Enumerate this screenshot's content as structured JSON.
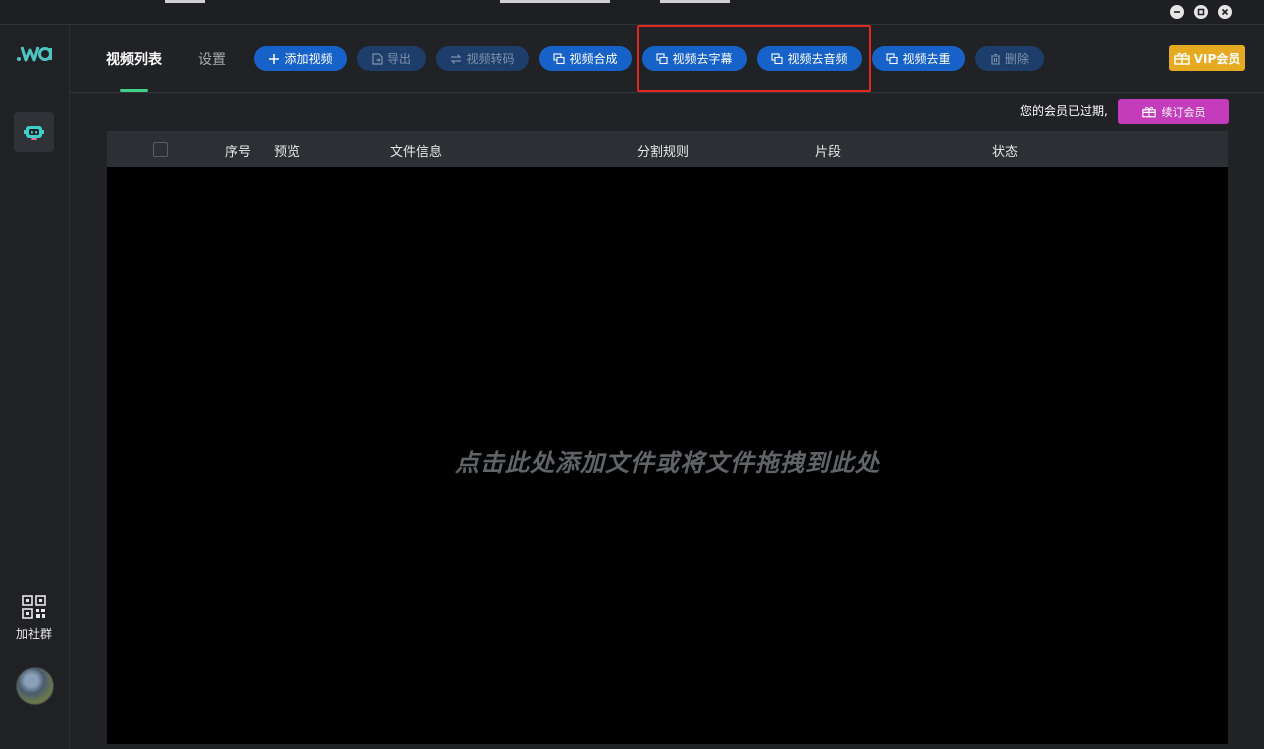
{
  "window": {
    "controls": [
      "minimize-icon",
      "maximize-icon",
      "close-icon"
    ]
  },
  "sidebar": {
    "logo_text": "wa",
    "qr_label": "加社群"
  },
  "tabs": [
    {
      "label": "视频列表",
      "active": true
    },
    {
      "label": "设置",
      "active": false
    }
  ],
  "toolbar": {
    "add_video": "添加视频",
    "export": "导出",
    "transcode": "视频转码",
    "merge": "视频合成",
    "remove_subtitle": "视频去字幕",
    "remove_audio": "视频去音频",
    "dedupe": "视频去重",
    "delete": "删除",
    "vip": "VIP会员"
  },
  "membership": {
    "expired_text": "您的会员已过期,",
    "renew_label": "续订会员"
  },
  "table": {
    "columns": [
      "序号",
      "预览",
      "文件信息",
      "分割规则",
      "片段",
      "状态"
    ],
    "empty_hint": "点击此处添加文件或将文件拖拽到此处"
  },
  "colors": {
    "accent_blue": "#1762c8",
    "tab_indicator": "#3ed086",
    "vip_gold": "#e5aa20",
    "renew_magenta": "#c43cbb",
    "highlight_red": "#e0281e"
  }
}
